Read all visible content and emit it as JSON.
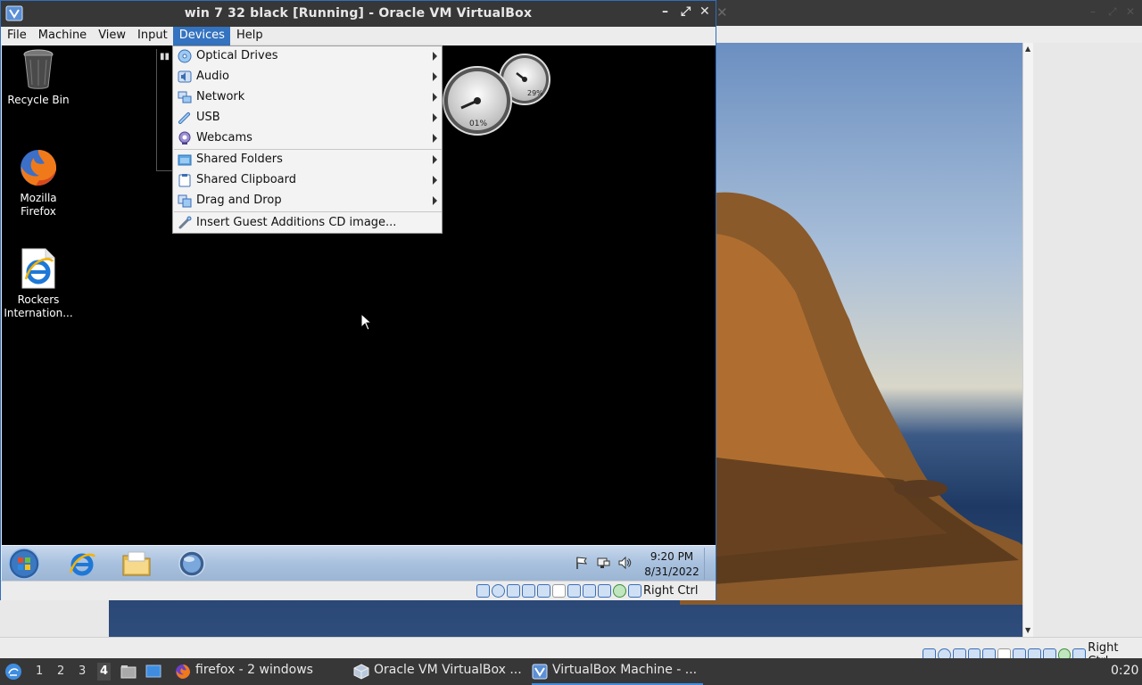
{
  "window": {
    "title": "win 7 32 black [Running] - Oracle VM VirtualBox",
    "controls": {
      "minimize": "–",
      "maximize": "⤢",
      "close": "✕"
    }
  },
  "menubar": [
    {
      "label": "File"
    },
    {
      "label": "Machine"
    },
    {
      "label": "View"
    },
    {
      "label": "Input"
    },
    {
      "label": "Devices",
      "active": true
    },
    {
      "label": "Help"
    }
  ],
  "devices_menu": {
    "items": [
      {
        "label": "Optical Drives",
        "icon": "optical-drive-icon",
        "submenu": true
      },
      {
        "label": "Audio",
        "icon": "audio-icon",
        "submenu": true
      },
      {
        "label": "Network",
        "icon": "network-icon",
        "submenu": true
      },
      {
        "label": "USB",
        "icon": "usb-icon",
        "submenu": true
      },
      {
        "label": "Webcams",
        "icon": "webcam-icon",
        "submenu": true
      },
      {
        "label": "Shared Folders",
        "icon": "shared-folder-icon",
        "submenu": true
      },
      {
        "label": "Shared Clipboard",
        "icon": "clipboard-icon",
        "submenu": true
      },
      {
        "label": "Drag and Drop",
        "icon": "drag-drop-icon",
        "submenu": true
      },
      {
        "label": "Insert Guest Additions CD image...",
        "icon": "guest-additions-icon",
        "submenu": false
      }
    ]
  },
  "guest_desktop": {
    "icons": [
      {
        "label": "Recycle Bin",
        "icon": "recycle-bin-icon"
      },
      {
        "label": "Mozilla Firefox",
        "icon": "firefox-icon"
      },
      {
        "label": "Rockers Internation...",
        "icon": "internet-explorer-icon"
      }
    ],
    "gauges": {
      "cpu_percent": "01%",
      "memory_percent": "29%"
    }
  },
  "guest_taskbar": {
    "pinned": [
      "start-orb-icon",
      "internet-explorer-icon",
      "file-explorer-icon",
      "media-center-icon"
    ],
    "tray_icons": [
      "action-center-flag-icon",
      "network-icon",
      "volume-icon"
    ],
    "time": "9:20 PM",
    "date": "8/31/2022"
  },
  "vm_status": {
    "host_key": "Right Ctrl"
  },
  "bg_window": {
    "host_key": "Right Ctrl"
  },
  "host_taskbar": {
    "workspaces": [
      "1",
      "2",
      "3",
      "4"
    ],
    "active_workspace": "4",
    "tasks": [
      {
        "label": "firefox - 2 windows",
        "icon": "firefox-icon"
      },
      {
        "label": "Oracle VM VirtualBox ...",
        "icon": "virtualbox-icon"
      },
      {
        "label": "VirtualBox Machine - ...",
        "icon": "virtualbox-icon",
        "active": true
      }
    ],
    "clock": "0:20"
  },
  "colors": {
    "accent": "#3473c0",
    "titlebar": "#373737",
    "menu_bg": "#f3f3f3"
  }
}
